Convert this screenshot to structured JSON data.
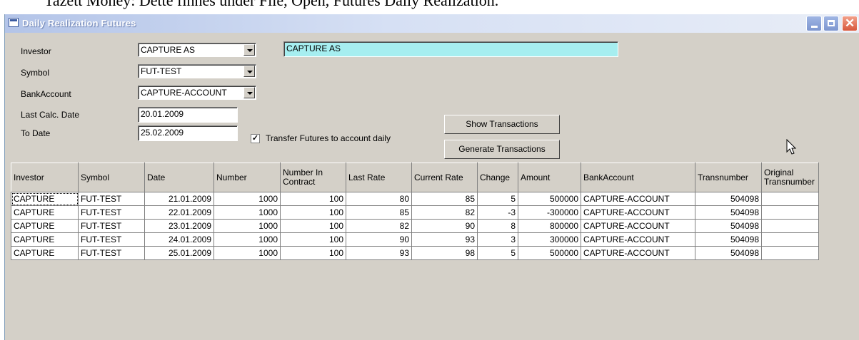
{
  "doc_text": "Tazett Money: Dette finnes under File, Open, Futures Daily Realization.",
  "window": {
    "title": "Daily Realization Futures"
  },
  "form": {
    "investor_label": "Investor",
    "investor_value": "CAPTURE AS",
    "investor_name": "CAPTURE AS",
    "symbol_label": "Symbol",
    "symbol_value": "FUT-TEST",
    "bank_label": "BankAccount",
    "bank_value": "CAPTURE-ACCOUNT",
    "last_calc_label": "Last Calc. Date",
    "last_calc_value": "20.01.2009",
    "to_date_label": "To Date",
    "to_date_value": "25.02.2009",
    "transfer_label": "Transfer Futures to account daily",
    "transfer_checked": true,
    "show_btn": "Show Transactions",
    "generate_btn": "Generate Transactions"
  },
  "table": {
    "headers": [
      "Investor",
      "Symbol",
      "Date",
      "Number",
      "Number In Contract",
      "Last Rate",
      "Current Rate",
      "Change",
      "Amount",
      "BankAccount",
      "Transnumber",
      "Original Transnumber"
    ],
    "rows": [
      [
        "CAPTURE",
        "FUT-TEST",
        "21.01.2009",
        "1000",
        "100",
        "80",
        "85",
        "5",
        "500000",
        "CAPTURE-ACCOUNT",
        "504098",
        ""
      ],
      [
        "CAPTURE",
        "FUT-TEST",
        "22.01.2009",
        "1000",
        "100",
        "85",
        "82",
        "-3",
        "-300000",
        "CAPTURE-ACCOUNT",
        "504098",
        ""
      ],
      [
        "CAPTURE",
        "FUT-TEST",
        "23.01.2009",
        "1000",
        "100",
        "82",
        "90",
        "8",
        "800000",
        "CAPTURE-ACCOUNT",
        "504098",
        ""
      ],
      [
        "CAPTURE",
        "FUT-TEST",
        "24.01.2009",
        "1000",
        "100",
        "90",
        "93",
        "3",
        "300000",
        "CAPTURE-ACCOUNT",
        "504098",
        ""
      ],
      [
        "CAPTURE",
        "FUT-TEST",
        "25.01.2009",
        "1000",
        "100",
        "93",
        "98",
        "5",
        "500000",
        "CAPTURE-ACCOUNT",
        "504098",
        ""
      ]
    ]
  }
}
